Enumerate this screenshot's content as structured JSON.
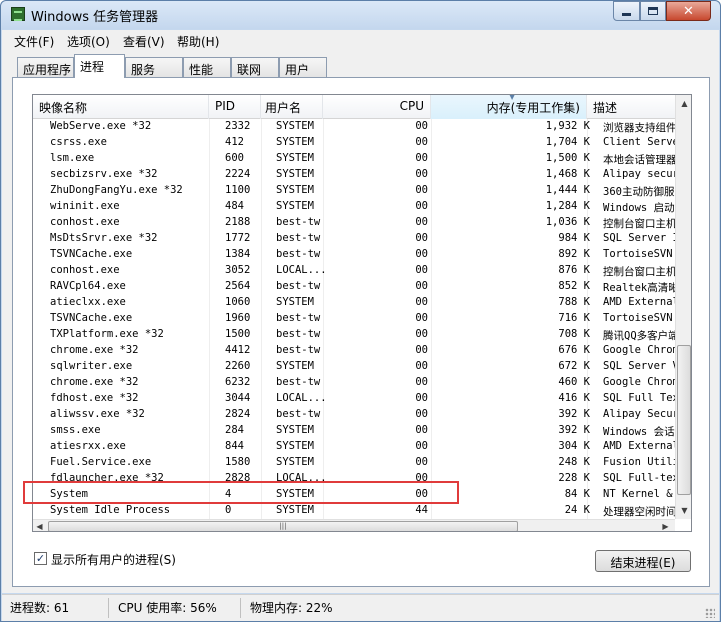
{
  "window": {
    "title": "Windows 任务管理器"
  },
  "menu": [
    {
      "label": "文件(F)"
    },
    {
      "label": "选项(O)"
    },
    {
      "label": "查看(V)"
    },
    {
      "label": "帮助(H)"
    }
  ],
  "tabs": [
    {
      "label": "应用程序"
    },
    {
      "label": "进程",
      "active": true
    },
    {
      "label": "服务"
    },
    {
      "label": "性能"
    },
    {
      "label": "联网"
    },
    {
      "label": "用户"
    }
  ],
  "columns": {
    "name": "映像名称",
    "pid": "PID",
    "user": "用户名",
    "cpu": "CPU",
    "mem": "内存(专用工作集)",
    "desc": "描述"
  },
  "processes": [
    {
      "name": "WebServe.exe *32",
      "pid": "2332",
      "user": "SYSTEM",
      "cpu": "00",
      "mem": "1,932 K",
      "desc": "浏览器支持组件"
    },
    {
      "name": "csrss.exe",
      "pid": "412",
      "user": "SYSTEM",
      "cpu": "00",
      "mem": "1,704 K",
      "desc": "Client Server"
    },
    {
      "name": "lsm.exe",
      "pid": "600",
      "user": "SYSTEM",
      "cpu": "00",
      "mem": "1,500 K",
      "desc": "本地会话管理器"
    },
    {
      "name": "secbizsrv.exe *32",
      "pid": "2224",
      "user": "SYSTEM",
      "cpu": "00",
      "mem": "1,468 K",
      "desc": "Alipay securi"
    },
    {
      "name": "ZhuDongFangYu.exe *32",
      "pid": "1100",
      "user": "SYSTEM",
      "cpu": "00",
      "mem": "1,444 K",
      "desc": "360主动防御服务"
    },
    {
      "name": "wininit.exe",
      "pid": "484",
      "user": "SYSTEM",
      "cpu": "00",
      "mem": "1,284 K",
      "desc": "Windows 启动应"
    },
    {
      "name": "conhost.exe",
      "pid": "2188",
      "user": "best-tw",
      "cpu": "00",
      "mem": "1,036 K",
      "desc": "控制台窗口主机"
    },
    {
      "name": "MsDtsSrvr.exe *32",
      "pid": "1772",
      "user": "best-tw",
      "cpu": "00",
      "mem": "984 K",
      "desc": "SQL Server Int"
    },
    {
      "name": "TSVNCache.exe",
      "pid": "1384",
      "user": "best-tw",
      "cpu": "00",
      "mem": "892 K",
      "desc": "TortoiseSVN st"
    },
    {
      "name": "conhost.exe",
      "pid": "3052",
      "user": "LOCAL...",
      "cpu": "00",
      "mem": "876 K",
      "desc": "控制台窗口主机"
    },
    {
      "name": "RAVCpl64.exe",
      "pid": "2564",
      "user": "best-tw",
      "cpu": "00",
      "mem": "852 K",
      "desc": "Realtek高清晰音"
    },
    {
      "name": "atieclxx.exe",
      "pid": "1060",
      "user": "SYSTEM",
      "cpu": "00",
      "mem": "788 K",
      "desc": "AMD External E"
    },
    {
      "name": "TSVNCache.exe",
      "pid": "1960",
      "user": "best-tw",
      "cpu": "00",
      "mem": "716 K",
      "desc": "TortoiseSVN st"
    },
    {
      "name": "TXPlatform.exe *32",
      "pid": "1500",
      "user": "best-tw",
      "cpu": "00",
      "mem": "708 K",
      "desc": "腾讯QQ多客户端"
    },
    {
      "name": "chrome.exe *32",
      "pid": "4412",
      "user": "best-tw",
      "cpu": "00",
      "mem": "676 K",
      "desc": "Google Chrome"
    },
    {
      "name": "sqlwriter.exe",
      "pid": "2260",
      "user": "SYSTEM",
      "cpu": "00",
      "mem": "672 K",
      "desc": "SQL Server VSS"
    },
    {
      "name": "chrome.exe *32",
      "pid": "6232",
      "user": "best-tw",
      "cpu": "00",
      "mem": "460 K",
      "desc": "Google Chrome"
    },
    {
      "name": "fdhost.exe *32",
      "pid": "3044",
      "user": "LOCAL...",
      "cpu": "00",
      "mem": "416 K",
      "desc": "SQL Full Text"
    },
    {
      "name": "aliwssv.exe *32",
      "pid": "2824",
      "user": "best-tw",
      "cpu": "00",
      "mem": "392 K",
      "desc": "Alipay Securit"
    },
    {
      "name": "smss.exe",
      "pid": "284",
      "user": "SYSTEM",
      "cpu": "00",
      "mem": "392 K",
      "desc": "Windows 会话管"
    },
    {
      "name": "atiesrxx.exe",
      "pid": "844",
      "user": "SYSTEM",
      "cpu": "00",
      "mem": "304 K",
      "desc": "AMD External E"
    },
    {
      "name": "Fuel.Service.exe",
      "pid": "1580",
      "user": "SYSTEM",
      "cpu": "00",
      "mem": "248 K",
      "desc": "Fusion Utility"
    },
    {
      "name": "fdlauncher.exe *32",
      "pid": "2828",
      "user": "LOCAL...",
      "cpu": "00",
      "mem": "228 K",
      "desc": "SQL Full-text"
    },
    {
      "name": "System",
      "pid": "4",
      "user": "SYSTEM",
      "cpu": "00",
      "mem": "84 K",
      "desc": "NT Kernel & Sy"
    },
    {
      "name": "System Idle Process",
      "pid": "0",
      "user": "SYSTEM",
      "cpu": "44",
      "mem": "24 K",
      "desc": "处理器空闲时间"
    }
  ],
  "show_all_users": {
    "label": "显示所有用户的进程(S)",
    "checked": true
  },
  "end_process_label": "结束进程(E)",
  "status": {
    "processes": "进程数: 61",
    "cpu": "CPU 使用率: 56%",
    "memory": "物理内存: 22%"
  },
  "colors": {
    "highlight_box": "#e03b3b"
  }
}
